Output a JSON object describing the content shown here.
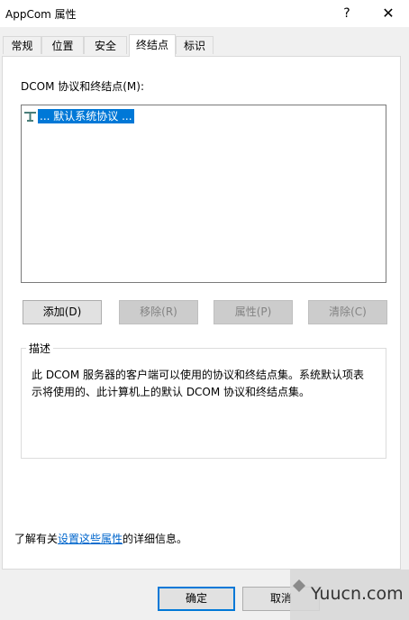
{
  "window": {
    "title": "AppCom 属性",
    "help_label": "?",
    "close_label": "✕"
  },
  "tabs": [
    {
      "label": "常规"
    },
    {
      "label": "位置"
    },
    {
      "label": "安全"
    },
    {
      "label": "终结点",
      "active": true
    },
    {
      "label": "标识"
    }
  ],
  "endpoints": {
    "label": "DCOM 协议和终结点(M):",
    "items": [
      {
        "label": "... 默认系统协议 ...",
        "icon": "network-protocol-icon",
        "selected": true
      }
    ]
  },
  "buttons": {
    "add": "添加(D)",
    "remove": "移除(R)",
    "properties": "属性(P)",
    "clear": "清除(C)"
  },
  "description": {
    "title": "描述",
    "line1": "此 DCOM 服务器的客户端可以使用的协议和终结点集。系统默认项表",
    "line2": "示将使用的、此计算机上的默认 DCOM 协议和终结点集。"
  },
  "info": {
    "prefix": "了解有关",
    "link": "设置这些属性",
    "suffix": "的详细信息。"
  },
  "dialog": {
    "ok": "确定",
    "cancel": "取消"
  },
  "watermark": {
    "text": "Yuucn.com"
  },
  "colors": {
    "selection": "#0078d7",
    "link": "#0066cc",
    "default_button_border": "#0078d7"
  }
}
